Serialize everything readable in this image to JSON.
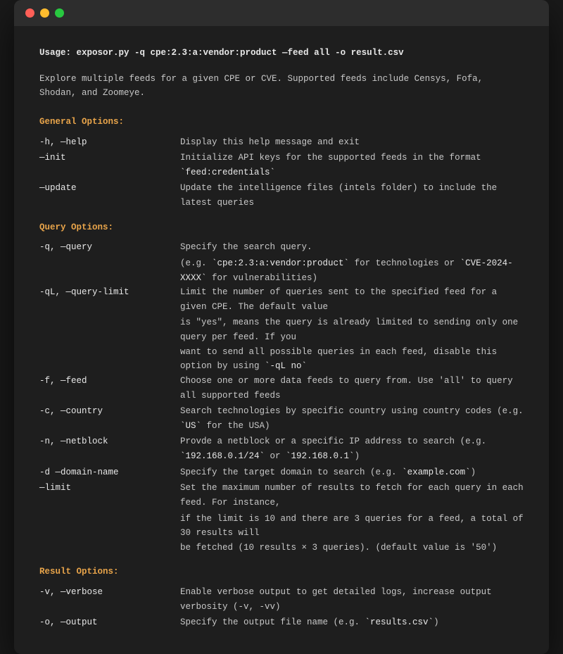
{
  "window": {
    "dots": [
      "red",
      "yellow",
      "green"
    ]
  },
  "terminal": {
    "usage_line": "Usage: exposor.py -q cpe:2.3:a:vendor:product —feed all -o result.csv",
    "description": "Explore multiple feeds for a given CPE or CVE. Supported feeds include Censys, Fofa, Shodan, and Zoomeye.",
    "sections": [
      {
        "header": "General Options:",
        "options": [
          {
            "name": "-h, —help",
            "desc": "Display this help message and exit"
          },
          {
            "name": "—init",
            "desc": "Initialize API keys for the supported feeds in the format `feed:credentials`"
          },
          {
            "name": "—update",
            "desc": "Update the intelligence files (intels folder) to include the latest queries"
          }
        ]
      },
      {
        "header": "Query Options:",
        "options": [
          {
            "name": "-q, —query",
            "desc": "Specify the search query.",
            "extra": "(e.g. `cpe:2.3:a:vendor:product` for technologies or `CVE-2024-XXXX` for vulnerabilities)"
          },
          {
            "name": "-qL, —query-limit",
            "desc": "Limit the number of queries sent to the specified feed for a given CPE. The default value",
            "extra2": [
              "is \"yes\", means the query is already limited to sending only one query per feed. If you",
              "want to send all possible queries in each feed, disable this option by using `-qL no`"
            ]
          },
          {
            "name": "-f, —feed",
            "desc": "Choose one or more data feeds to query from. Use 'all' to query all supported feeds"
          },
          {
            "name": "-c, —country",
            "desc": "Search technologies by specific country using country codes (e.g. `US` for the USA)"
          },
          {
            "name": "-n, —netblock",
            "desc": "Provde a netblock or a specific IP address to search (e.g. `192.168.0.1/24` or `192.168.0.1`)"
          },
          {
            "name": "-d —domain-name",
            "desc": "Specify the target domain to search (e.g. `example.com`)"
          },
          {
            "name": "—limit",
            "desc": "Set the maximum number of results to fetch for each query in each feed. For instance,",
            "extra2": [
              "if the limit is 10 and there are 3 queries for a feed, a total of 30 results will",
              "be fetched (10 results × 3 queries). (default value is '50')"
            ]
          }
        ]
      },
      {
        "header": "Result Options:",
        "options": [
          {
            "name": "-v, —verbose",
            "desc": "Enable verbose output to get detailed logs, increase output verbosity (-v, -vv)"
          },
          {
            "name": "-o, —output",
            "desc": "Specify the output file name (e.g. `results.csv`)"
          }
        ]
      }
    ]
  }
}
